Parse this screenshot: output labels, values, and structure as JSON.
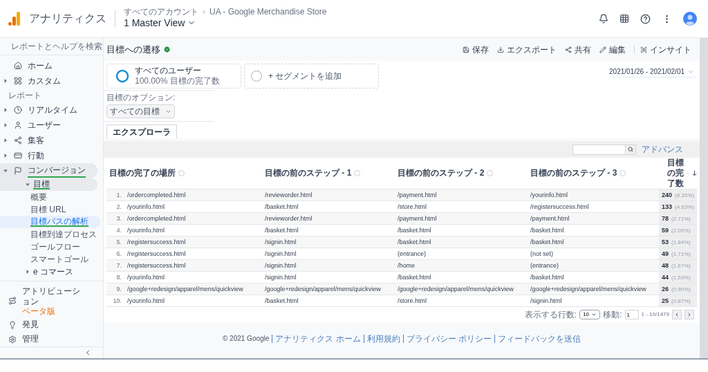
{
  "header": {
    "product": "アナリティクス",
    "breadcrumb": [
      "すべてのアカウント",
      "UA - Google Merchandise Store"
    ],
    "view": "1 Master View"
  },
  "sidebar": {
    "search_placeholder": "レポートとヘルプを検索",
    "top_items": [
      {
        "label": "ホーム"
      },
      {
        "label": "カスタム",
        "expanded": false
      }
    ],
    "section_label": "レポート",
    "report_items": [
      {
        "label": "リアルタイム",
        "expanded": false
      },
      {
        "label": "ユーザー",
        "expanded": false
      },
      {
        "label": "集客",
        "expanded": false
      },
      {
        "label": "行動",
        "expanded": false
      },
      {
        "label": "コンバージョン",
        "expanded": true,
        "children": [
          {
            "label": "目標",
            "expanded": true,
            "children": [
              {
                "label": "概要",
                "selected": false
              },
              {
                "label": "目標 URL",
                "selected": false
              },
              {
                "label": "目標パスの解析",
                "selected": true
              },
              {
                "label": "目標到達プロセス",
                "selected": false
              },
              {
                "label": "ゴールフロー",
                "selected": false
              },
              {
                "label": "スマートゴール",
                "selected": false
              }
            ]
          },
          {
            "label": "e コマース",
            "expanded": false
          }
        ]
      }
    ],
    "bottom_items": [
      {
        "label": "アトリビューション",
        "badge": "ベータ版"
      },
      {
        "label": "発見"
      },
      {
        "label": "管理"
      }
    ]
  },
  "main": {
    "title": "目標への遷移",
    "actions": [
      "保存",
      "エクスポート",
      "共有",
      "編集",
      "インサイト"
    ],
    "segments": [
      {
        "kind": "active",
        "name": "すべてのユーザー",
        "detail": "100.00% 目標の完了数"
      },
      {
        "kind": "add",
        "name": "+ セグメントを追加"
      }
    ],
    "date_range": "2021/01/26 - 2021/02/01",
    "options_label": "目標のオプション:",
    "options_value": "すべての目標",
    "tabs": [
      {
        "label": "エクスプローラ",
        "selected": true
      }
    ],
    "advanced_link": "アドバンス",
    "table": {
      "columns": [
        "目標の完了の場所",
        "目標の前のステップ - 1",
        "目標の前のステップ - 2",
        "目標の前のステップ - 3",
        "目標の完了数"
      ],
      "rows": [
        {
          "index": "1.",
          "cells": [
            "/ordercompleted.html",
            "/revieworder.html",
            "/payment.html",
            "/yourinfo.html"
          ],
          "count": "240",
          "share": "(8.35%)"
        },
        {
          "index": "2.",
          "cells": [
            "/yourinfo.html",
            "/basket.html",
            "/store.html",
            "/registersuccess.html"
          ],
          "count": "133",
          "share": "(4.63%)"
        },
        {
          "index": "3.",
          "cells": [
            "/ordercompleted.html",
            "/revieworder.html",
            "/payment.html",
            "/payment.html"
          ],
          "count": "78",
          "share": "(2.71%)"
        },
        {
          "index": "4.",
          "cells": [
            "/yourinfo.html",
            "/basket.html",
            "/basket.html",
            "/basket.html"
          ],
          "count": "59",
          "share": "(2.05%)"
        },
        {
          "index": "5.",
          "cells": [
            "/registersuccess.html",
            "/signin.html",
            "/basket.html",
            "/basket.html"
          ],
          "count": "53",
          "share": "(1.84%)"
        },
        {
          "index": "6.",
          "cells": [
            "/registersuccess.html",
            "/signin.html",
            "(entrance)",
            "(not set)"
          ],
          "count": "49",
          "share": "(1.71%)"
        },
        {
          "index": "7.",
          "cells": [
            "/registersuccess.html",
            "/signin.html",
            "/home",
            "(entrance)"
          ],
          "count": "48",
          "share": "(1.67%)"
        },
        {
          "index": "8.",
          "cells": [
            "/yourinfo.html",
            "/signin.html",
            "/basket.html",
            "/basket.html"
          ],
          "count": "44",
          "share": "(1.53%)"
        },
        {
          "index": "9.",
          "cells": [
            "/google+redesign/apparel/mens/quickview",
            "/google+redesign/apparel/mens/quickview",
            "/google+redesign/apparel/mens/quickview",
            "/google+redesign/apparel/mens/quickview"
          ],
          "count": "26",
          "share": "(0.90%)"
        },
        {
          "index": "10.",
          "cells": [
            "/yourinfo.html",
            "/basket.html",
            "/store.html",
            "/signin.html"
          ],
          "count": "25",
          "share": "(0.87%)"
        }
      ]
    },
    "pagination": {
      "rows_label": "表示する行数:",
      "rows_value": "10",
      "goto_label": "移動:",
      "goto_value": "1",
      "range": "1 - 10/1479"
    },
    "footer": {
      "copyright": "© 2021 Google",
      "links": [
        "アナリティクス ホーム",
        "利用規約",
        "プライバシー ポリシー",
        "フィードバックを送信"
      ]
    }
  }
}
